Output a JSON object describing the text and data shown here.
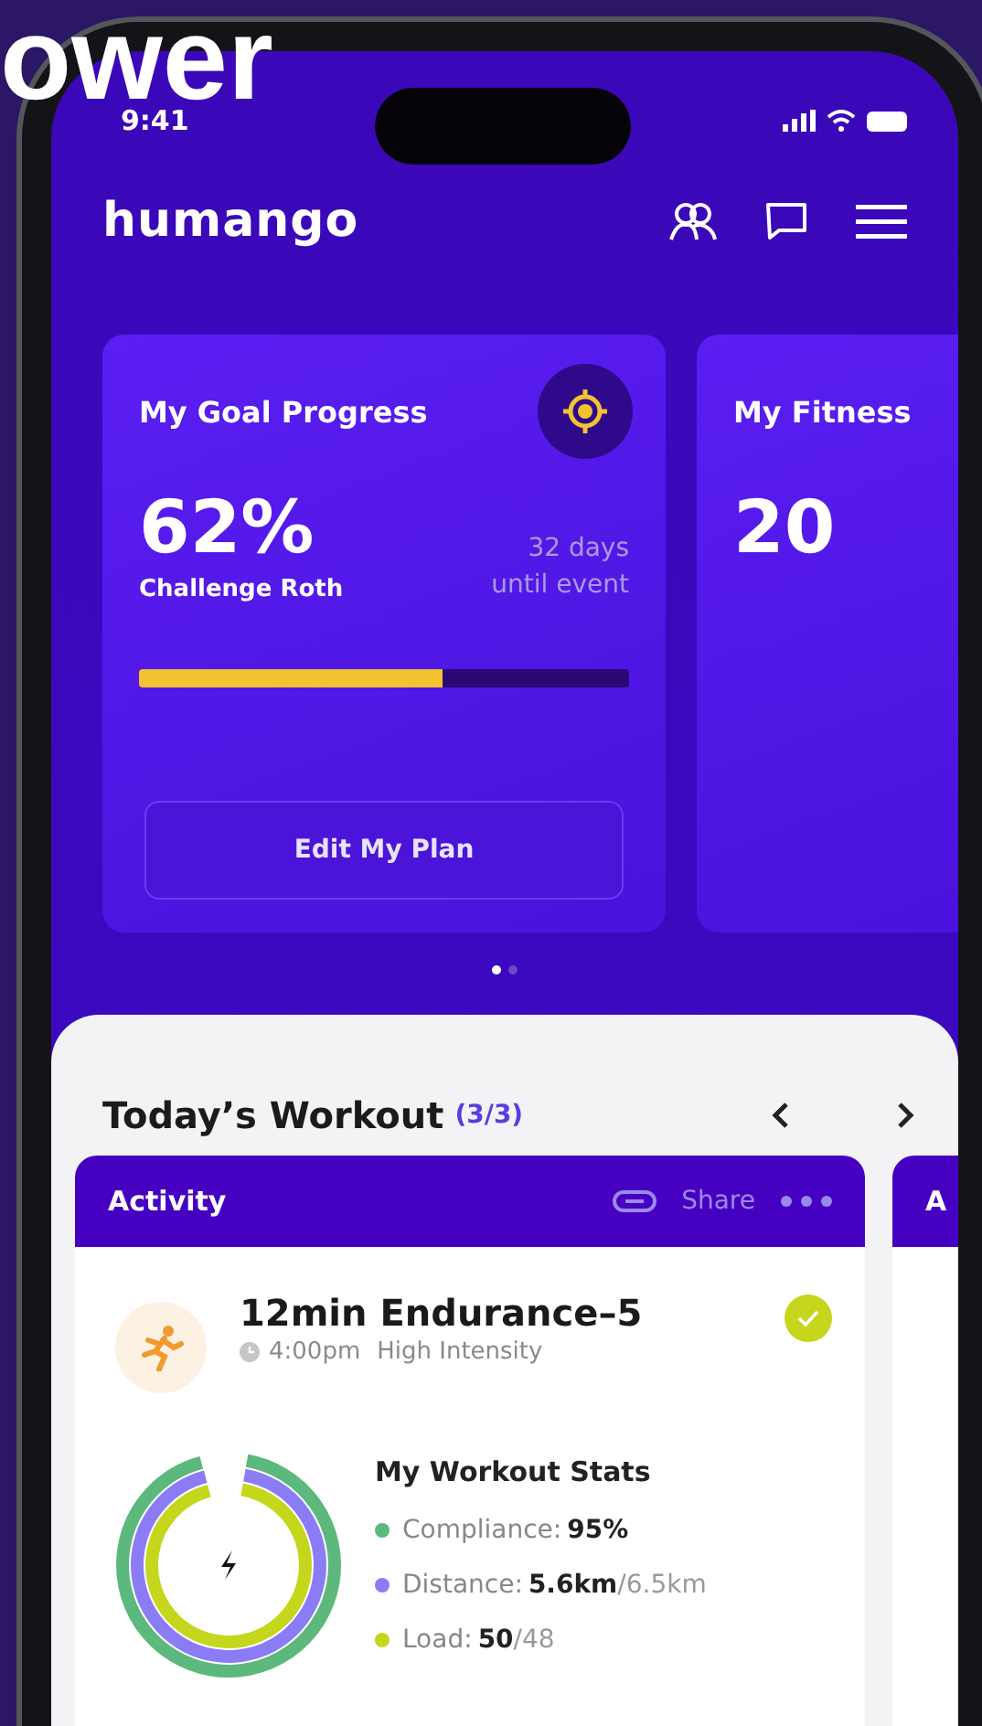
{
  "backdrop_heading": "ower",
  "status_bar": {
    "time": "9:41"
  },
  "header": {
    "logo": "humango"
  },
  "cards": [
    {
      "kind": "goal",
      "title": "My Goal Progress",
      "value": "62%",
      "subtitle": "Challenge Roth",
      "countdown": [
        "32 days",
        "until event"
      ],
      "level": 0.62,
      "button": "Edit My Plan"
    },
    {
      "kind": "fitness",
      "title": "My Fitness",
      "value": "20"
    }
  ],
  "pager": [
    {
      "selected": true
    },
    {
      "selected": false
    }
  ],
  "workout": {
    "title": "Today’s Workout",
    "count": "(3/3)",
    "cards": [
      {
        "header": "Activity",
        "share": "Share",
        "name": "12min Endurance–5",
        "time": "4:00pm",
        "intensity": "High Intensity",
        "done": true,
        "stats_title": "My Workout Stats",
        "stats": [
          {
            "label": "Compliance:",
            "value": "95%",
            "color": "#5cb87c"
          },
          {
            "label": "Distance:",
            "value": "5.6km",
            "total": "/6.5km",
            "color": "#8b7cf6"
          },
          {
            "label": "Load:",
            "value": "50",
            "total": "/48",
            "color": "#c5d61c"
          }
        ]
      },
      {
        "header": "A"
      }
    ]
  }
}
